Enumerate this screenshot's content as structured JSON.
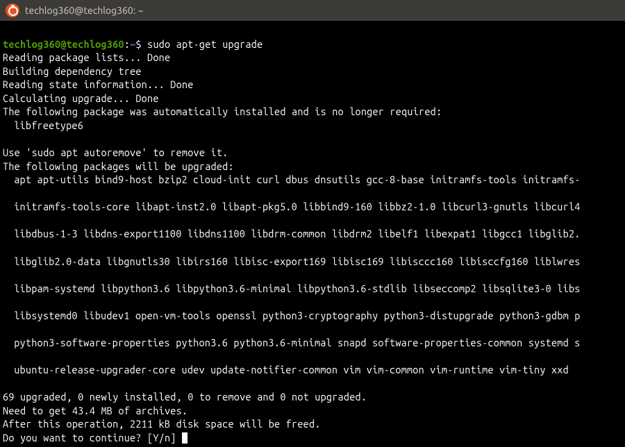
{
  "window": {
    "title": "techlog360@techlog360: ~"
  },
  "prompt": {
    "userhost": "techlog360@techlog360",
    "sep": ":",
    "path": "~",
    "symbol": "$"
  },
  "command": "sudo apt-get upgrade",
  "output": {
    "l1": "Reading package lists... Done",
    "l2": "Building dependency tree",
    "l3": "Reading state information... Done",
    "l4": "Calculating upgrade... Done",
    "l5": "The following package was automatically installed and is no longer required:",
    "l6": "libfreetype6",
    "l7": "Use 'sudo apt autoremove' to remove it.",
    "l8": "The following packages will be upgraded:",
    "l9": "apt apt-utils bind9-host bzip2 cloud-init curl dbus dnsutils gcc-8-base initramfs-tools initramfs-",
    "l10": "initramfs-tools-core libapt-inst2.0 libapt-pkg5.0 libbind9-160 libbz2-1.0 libcurl3-gnutls libcurl4",
    "l11": "libdbus-1-3 libdns-export1100 libdns1100 libdrm-common libdrm2 libelf1 libexpat1 libgcc1 libglib2.",
    "l12": "libglib2.0-data libgnutls30 libirs160 libisc-export169 libisc169 libisccc160 libisccfg160 liblwres",
    "l13": "libpam-systemd libpython3.6 libpython3.6-minimal libpython3.6-stdlib libseccomp2 libsqlite3-0 libs",
    "l14": "libsystemd0 libudev1 open-vm-tools openssl python3-cryptography python3-distupgrade python3-gdbm p",
    "l15": "python3-software-properties python3.6 python3.6-minimal snapd software-properties-common systemd s",
    "l16": "ubuntu-release-upgrader-core udev update-notifier-common vim vim-common vim-runtime vim-tiny xxd",
    "l17": "69 upgraded, 0 newly installed, 0 to remove and 0 not upgraded.",
    "l18": "Need to get 43.4 MB of archives.",
    "l19": "After this operation, 2211 kB disk space will be freed.",
    "l20": "Do you want to continue? [Y/n] "
  }
}
